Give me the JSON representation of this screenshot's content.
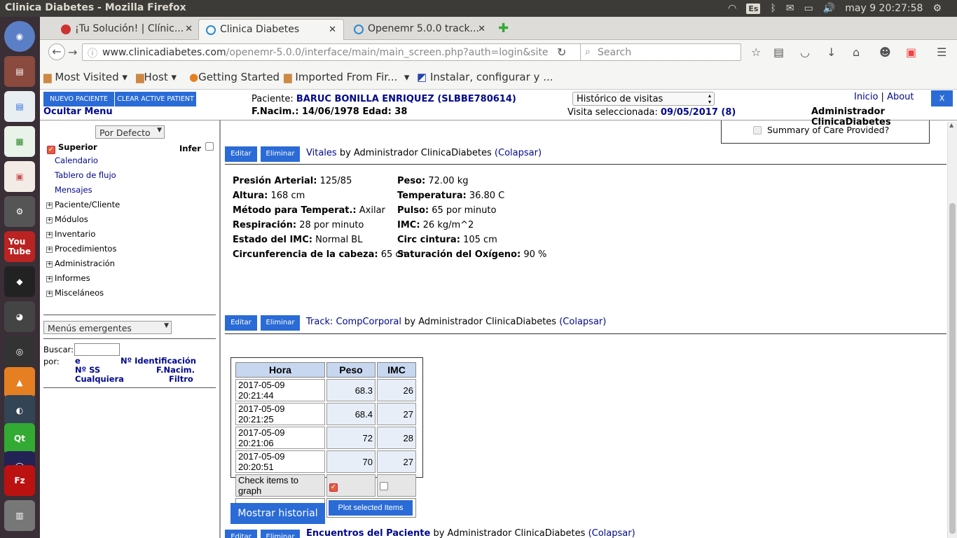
{
  "os": {
    "window_title": "Clinica Diabetes - Mozilla Firefox",
    "keyboard_layout": "Es",
    "clock": "may 9 20:27:58"
  },
  "browser": {
    "tabs": [
      {
        "label": "¡Tu Solución! | Clínic...",
        "active": false
      },
      {
        "label": "Clinica Diabetes",
        "active": true
      },
      {
        "label": "Openemr 5.0.0 track...",
        "active": false
      }
    ],
    "url_domain": "www.clinicadiabetes.com",
    "url_path": "/openemr-5.0.0/interface/main/main_screen.php?auth=login&site",
    "search_placeholder": "Search",
    "bookmarks": [
      "Most Visited",
      "Host",
      "Getting Started",
      "Imported From Fir...",
      "Instalar, configurar y ..."
    ]
  },
  "header": {
    "new_patient": "NUEVO PACIENTE",
    "clear_patient": "CLEAR ACTIVE PATIENT",
    "hide_menu": "Ocultar Menu",
    "patient_label": "Paciente:",
    "patient_name": "BARUC BONILLA ENRIQUEZ (SLBBE780614)",
    "dob_line": "F.Nacim.: 14/06/1978 Edad: 38",
    "visit_history": "Histórico de visitas",
    "visit_selected_label": "Visita seleccionada:",
    "visit_selected_value": "09/05/2017 (8)",
    "inicio": "Inicio",
    "about": "About",
    "close": "X",
    "admin": "Administrador ClinicaDiabetes"
  },
  "sidebar": {
    "default_select": "Por Defecto",
    "superior": "Superior",
    "infer": "Infer",
    "links": [
      "Calendario",
      "Tablero de flujo",
      "Mensajes"
    ],
    "groups": [
      "Paciente/Cliente",
      "Módulos",
      "Inventario",
      "Procedimientos",
      "Administración",
      "Informes",
      "Misceláneos"
    ],
    "popup_menus": "Menús emergentes",
    "search_label": "Buscar:",
    "by_label": "por:",
    "search_opts": [
      "e",
      "Nº Identificación",
      "Nº SS",
      "F.Nacim.",
      "Cualquiera",
      "Filtro"
    ]
  },
  "main": {
    "summary_care": "Summary of Care Provided?",
    "edit": "Editar",
    "delete": "Eliminar",
    "by_admin": "by Administrador ClinicaDiabetes",
    "collapse": "(Colapsar)",
    "vitals_title": "Vitales",
    "vitals_left": [
      {
        "k": "Presión Arterial:",
        "v": "125/85"
      },
      {
        "k": "Altura:",
        "v": "168 cm"
      },
      {
        "k": "Método para Temperat.:",
        "v": "Axilar"
      },
      {
        "k": "Respiración:",
        "v": "28 por minuto"
      },
      {
        "k": "Estado del IMC:",
        "v": "Normal BL"
      },
      {
        "k": "Circunferencia de la cabeza:",
        "v": "65 cm"
      }
    ],
    "vitals_right": [
      {
        "k": "Peso:",
        "v": "72.00 kg"
      },
      {
        "k": "Temperatura:",
        "v": "36.80 C"
      },
      {
        "k": "Pulso:",
        "v": "65 por minuto"
      },
      {
        "k": "IMC:",
        "v": "26 kg/m^2"
      },
      {
        "k": "Circ cintura:",
        "v": "105 cm"
      },
      {
        "k": "Saturación del Oxígeno:",
        "v": "90 %"
      }
    ],
    "track_title": "Track: CompCorporal",
    "track_headers": [
      "Hora",
      "Peso",
      "IMC"
    ],
    "track_rows": [
      [
        "2017-05-09 20:21:44",
        "68.3",
        "26"
      ],
      [
        "2017-05-09 20:21:25",
        "68.4",
        "27"
      ],
      [
        "2017-05-09 20:21:06",
        "72",
        "28"
      ],
      [
        "2017-05-09 20:20:51",
        "70",
        "27"
      ]
    ],
    "check_graph": "Check items to graph",
    "plot_btn": "Plot selected Items",
    "show_history": "Mostrar historial",
    "encounters_title": "Encuentros del Paciente"
  }
}
